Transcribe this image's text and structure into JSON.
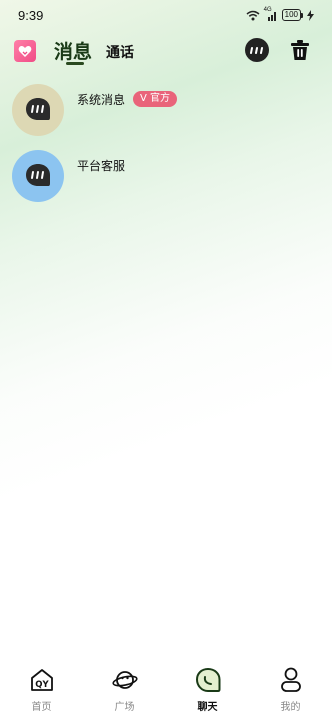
{
  "status_bar": {
    "time": "9:39",
    "signal_type": "4G",
    "battery": "100"
  },
  "header": {
    "tabs": [
      {
        "label": "消息",
        "active": true
      },
      {
        "label": "通话",
        "active": false
      }
    ],
    "icons": {
      "logo": "heart-logo-icon",
      "chat": "chat-bubble-icon",
      "trash": "trash-icon"
    }
  },
  "messages": [
    {
      "name": "系统消息",
      "badge": "V 官方",
      "avatar_color": "#ddd8b4"
    },
    {
      "name": "平台客服",
      "badge": "",
      "avatar_color": "#8cc4f0"
    }
  ],
  "bottom_nav": [
    {
      "label": "首页",
      "icon": "home-qy-icon",
      "active": false
    },
    {
      "label": "广场",
      "icon": "planet-icon",
      "active": false
    },
    {
      "label": "聊天",
      "icon": "chat-leaf-icon",
      "active": true
    },
    {
      "label": "我的",
      "icon": "person-icon",
      "active": false
    }
  ],
  "colors": {
    "accent": "#2a4a20",
    "badge": "#e9647a",
    "logo": "#f04c86"
  }
}
